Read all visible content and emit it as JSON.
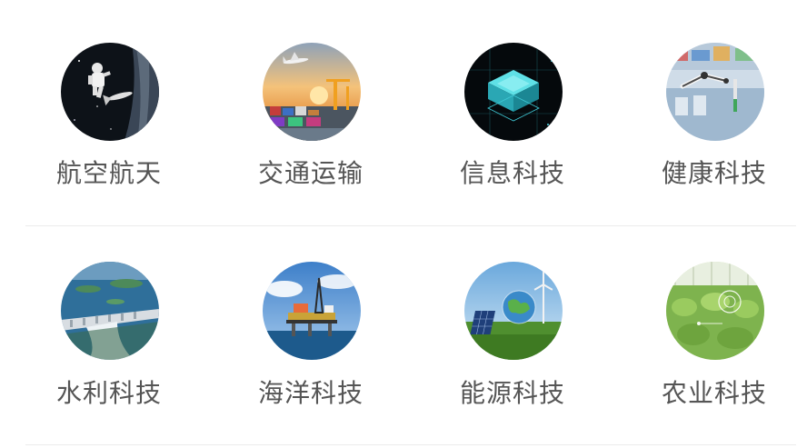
{
  "categories": [
    {
      "label": "航空航天",
      "icon": "aerospace-icon"
    },
    {
      "label": "交通运输",
      "icon": "transportation-icon"
    },
    {
      "label": "信息科技",
      "icon": "information-technology-icon"
    },
    {
      "label": "健康科技",
      "icon": "health-technology-icon"
    },
    {
      "label": "水利科技",
      "icon": "water-conservancy-icon"
    },
    {
      "label": "海洋科技",
      "icon": "ocean-technology-icon"
    },
    {
      "label": "能源科技",
      "icon": "energy-technology-icon"
    },
    {
      "label": "农业科技",
      "icon": "agriculture-technology-icon"
    }
  ],
  "colors": {
    "label_text": "#555555",
    "divider": "#ececec",
    "background": "#ffffff"
  }
}
